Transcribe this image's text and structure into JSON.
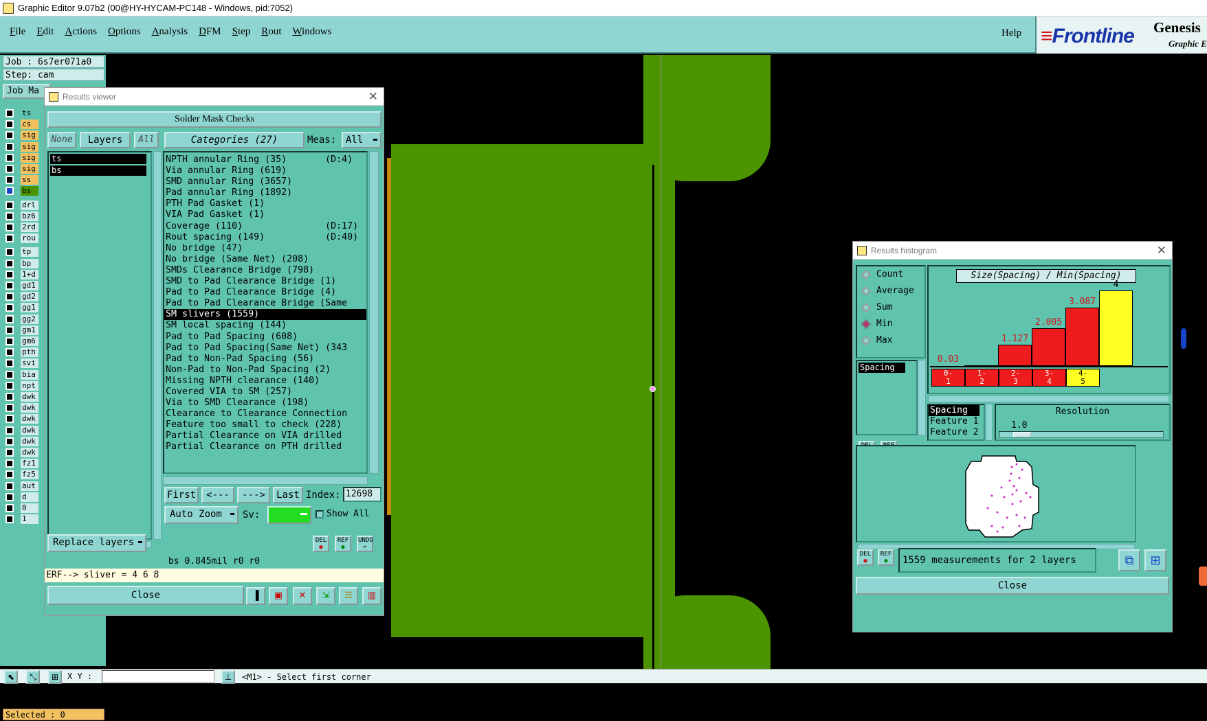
{
  "window": {
    "title": "Graphic Editor 9.07b2 (00@HY-HYCAM-PC148 - Windows, pid:7052)"
  },
  "menubar": {
    "items": [
      "File",
      "Edit",
      "Actions",
      "Options",
      "Analysis",
      "DFM",
      "Step",
      "Rout",
      "Windows"
    ],
    "help": "Help"
  },
  "brand": {
    "logo": "Frontline",
    "product": "Genesis",
    "subtitle": "Graphic E"
  },
  "job": {
    "job_line": "Job : 6s7er071a0",
    "step_line": "Step: cam",
    "matrix_tab": "Job Ma"
  },
  "layers": [
    {
      "name": "ts",
      "color": "#5fc3ae"
    },
    {
      "name": "cs",
      "color": "#f3c260"
    },
    {
      "name": "sig",
      "color": "#f3c260"
    },
    {
      "name": "sig",
      "color": "#f3c260"
    },
    {
      "name": "sig",
      "color": "#f3c260"
    },
    {
      "name": "sig",
      "color": "#f3c260"
    },
    {
      "name": "ss",
      "color": "#f3c260"
    },
    {
      "name": "bs",
      "color": "#4b9400"
    },
    {
      "name": "drl",
      "color": "#cfeceb"
    },
    {
      "name": "bz6",
      "color": "#cfeceb"
    },
    {
      "name": "2rd",
      "color": "#cfeceb"
    },
    {
      "name": "rou",
      "color": "#cfeceb"
    },
    {
      "name": "tp",
      "color": "#cfeceb"
    },
    {
      "name": "bp",
      "color": "#cfeceb"
    },
    {
      "name": "1+d",
      "color": "#cfeceb"
    },
    {
      "name": "gd1",
      "color": "#cfeceb"
    },
    {
      "name": "gd2",
      "color": "#cfeceb"
    },
    {
      "name": "gg1",
      "color": "#cfeceb"
    },
    {
      "name": "gg2",
      "color": "#cfeceb"
    },
    {
      "name": "gm1",
      "color": "#cfeceb"
    },
    {
      "name": "gm6",
      "color": "#cfeceb"
    },
    {
      "name": "pth",
      "color": "#cfeceb"
    },
    {
      "name": "svi",
      "color": "#cfeceb"
    },
    {
      "name": "bia",
      "color": "#cfeceb"
    },
    {
      "name": "npt",
      "color": "#cfeceb"
    },
    {
      "name": "dwk",
      "color": "#cfeceb"
    },
    {
      "name": "dwk",
      "color": "#cfeceb"
    },
    {
      "name": "dwk",
      "color": "#cfeceb"
    },
    {
      "name": "dwk",
      "color": "#cfeceb"
    },
    {
      "name": "dwk",
      "color": "#cfeceb"
    },
    {
      "name": "dwk",
      "color": "#cfeceb"
    },
    {
      "name": "fz1",
      "color": "#cfeceb"
    },
    {
      "name": "fz5",
      "color": "#cfeceb"
    },
    {
      "name": "aut",
      "color": "#cfeceb"
    },
    {
      "name": "d",
      "color": "#cfeceb"
    },
    {
      "name": "0",
      "color": "#cfeceb"
    },
    {
      "name": "1",
      "color": "#cfeceb"
    }
  ],
  "selected": "Selected : 0",
  "results_viewer": {
    "title": "Results viewer",
    "header": "Solder Mask Checks",
    "none_btn": "None",
    "layers_btn": "Layers",
    "all_btn": "All",
    "categories_btn": "Categories (27)",
    "meas_label": "Meas:",
    "meas_value": "All",
    "layer_list": [
      "ts",
      "bs"
    ],
    "categories": [
      "NPTH annular Ring (35)       (D:4)",
      "Via annular Ring (619)",
      "SMD annular Ring (3657)",
      "Pad annular Ring (1892)",
      "PTH Pad Gasket (1)",
      "VIA Pad Gasket (1)",
      "Coverage (110)               (D:17)",
      "Rout spacing (149)           (D:40)",
      "No bridge (47)",
      "No bridge (Same Net) (208)",
      "SMDs Clearance Bridge (798)",
      "SMD to Pad Clearance Bridge (1)",
      "Pad to Pad Clearance Bridge (4)",
      "Pad to Pad Clearance Bridge (Same",
      "SM slivers (1559)",
      "SM local spacing (144)",
      "Pad to Pad Spacing (608)",
      "Pad to Pad Spacing(Same Net) (343",
      "Pad to Non-Pad Spacing (56)",
      "Non-Pad to Non-Pad Spacing (2)",
      "Missing NPTH clearance (140)",
      "Covered VIA to SM (257)",
      "Via to SMD Clearance (198)",
      "Clearance to Clearance Connection",
      "Feature too small to check (228)",
      "Partial Clearance on VIA drilled",
      "Partial Clearance on PTH drilled"
    ],
    "selected_category": "SM slivers (1559)",
    "nav": {
      "first": "First",
      "prev": "<---",
      "next": "--->",
      "last": "Last",
      "index_label": "Index:",
      "index_value": "12698"
    },
    "auto_zoom": "Auto Zoom",
    "sv_label": "Sv:",
    "show_all": "Show All",
    "replace_layers": "Replace layers",
    "del": "DEL",
    "ref": "REF",
    "undo": "UNDO",
    "info_line": "bs 0.845mil  r0  r0",
    "erf_line": "ERF--> sliver = 4 6 8",
    "close": "Close",
    "sv_color": "#22dd22"
  },
  "histogram": {
    "title": "Results histogram",
    "modes": [
      "Count",
      "Average",
      "Sum",
      "Min",
      "Max"
    ],
    "selected_mode": "Min",
    "measure_list": [
      "Spacing"
    ],
    "chart_title": "Size(Spacing) / Min(Spacing)",
    "chart_data": {
      "type": "bar",
      "title": "Size(Spacing) / Min(Spacing)",
      "categories": [
        "0-1",
        "1-2",
        "2-3",
        "3-4",
        "4-5"
      ],
      "values": [
        0.03,
        1.127,
        2.005,
        3.087,
        4
      ],
      "value_labels": [
        "0.03",
        "1.127",
        "2.005",
        "3.087",
        "4"
      ],
      "bin_labels": [
        [
          "0-",
          "1"
        ],
        [
          "1-",
          "2"
        ],
        [
          "2-",
          "3"
        ],
        [
          "3-",
          "4"
        ],
        [
          "4-",
          "5"
        ]
      ],
      "colors": [
        "#ee1c1c",
        "#ee1c1c",
        "#ee1c1c",
        "#ee1c1c",
        "#ffff22"
      ],
      "ylim": [
        0,
        4
      ]
    },
    "attr_list": [
      "Spacing",
      "Feature 1",
      "Feature 2"
    ],
    "resolution_label": "Resolution",
    "resolution_value": "1.0",
    "status": "1559 measurements for 2 layers",
    "close": "Close"
  },
  "statusbar": {
    "xy_label": "X Y :",
    "prompt": "<M1> - Select first corner"
  },
  "colors": {
    "panel": "#5fc3ae",
    "light": "#8fd6d2",
    "copper": "#4b9400",
    "highlight": "#000000"
  }
}
